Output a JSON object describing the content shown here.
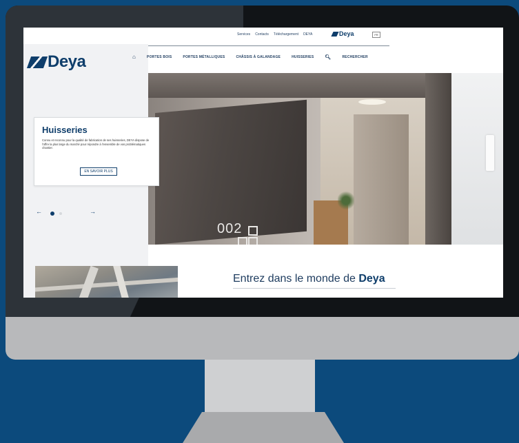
{
  "toplinks": [
    "Services",
    "Contacts",
    "Téléchargement",
    "DEYA"
  ],
  "brand": {
    "name": "Deya"
  },
  "lang": "FR",
  "nav": {
    "items": [
      "PORTES BOIS",
      "PORTES MÉTALLIQUES",
      "CHÂSSIS À GALANDAGE",
      "HUISSERIES"
    ],
    "search_label": "RECHERCHER"
  },
  "hero": {
    "door_number": "002",
    "card_title": "Huisseries",
    "card_text": "Connu et reconnu pour la qualité de fabrication de ses huisseries, DEYA dispose de l'offre la plus large du marché pour répondre à l'ensemble de vos problématiques chantier.",
    "card_button": "EN SAVOIR PLUS"
  },
  "slider": {
    "prev": "←",
    "next": "→"
  },
  "welcome": {
    "prefix": "Entrez dans le monde de ",
    "brand": "Deya"
  }
}
